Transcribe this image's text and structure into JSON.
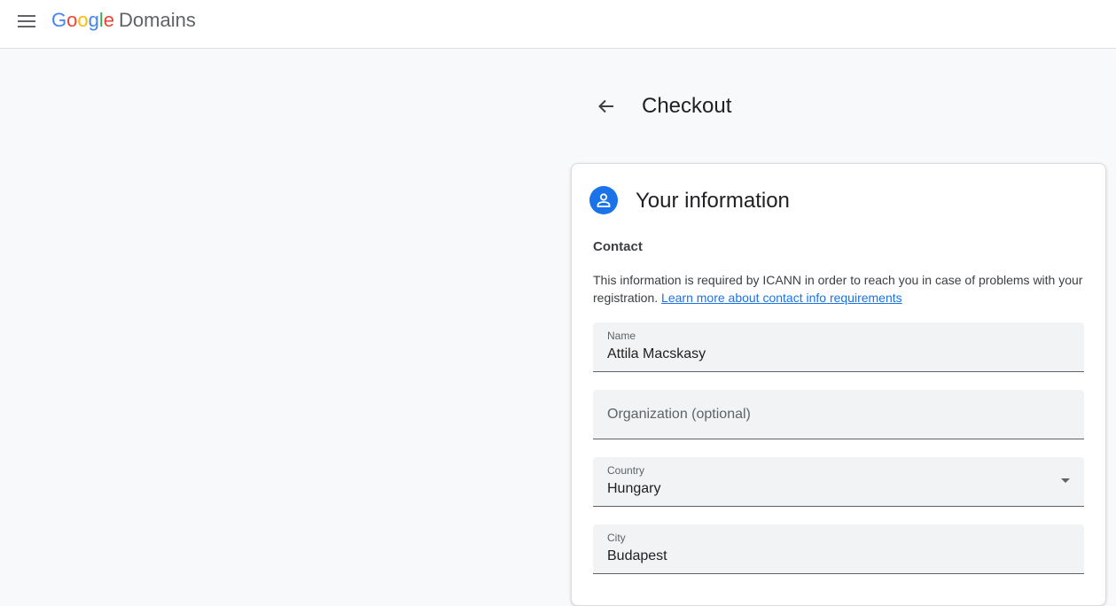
{
  "header": {
    "logo_letters": [
      "G",
      "o",
      "o",
      "g",
      "l",
      "e"
    ],
    "product_name": "Domains"
  },
  "page": {
    "title": "Checkout"
  },
  "card": {
    "section_title": "Your information",
    "subheading": "Contact",
    "description": "This information is required by ICANN in order to reach you in case of problems with your registration.",
    "link_text": "Learn more about contact info requirements",
    "fields": {
      "name": {
        "label": "Name",
        "value": "Attila Macskasy"
      },
      "organization": {
        "placeholder": "Organization (optional)"
      },
      "country": {
        "label": "Country",
        "value": "Hungary"
      },
      "city": {
        "label": "City",
        "value": "Budapest"
      }
    }
  },
  "colors": {
    "accent": "#1a73e8",
    "google_blue": "#4285f4",
    "google_red": "#ea4335",
    "google_yellow": "#fbbc05",
    "google_green": "#34a853"
  },
  "icons": {
    "menu": "hamburger-menu-icon",
    "back": "arrow-back-icon",
    "section": "person-icon",
    "dropdown": "arrow-drop-down-icon"
  }
}
